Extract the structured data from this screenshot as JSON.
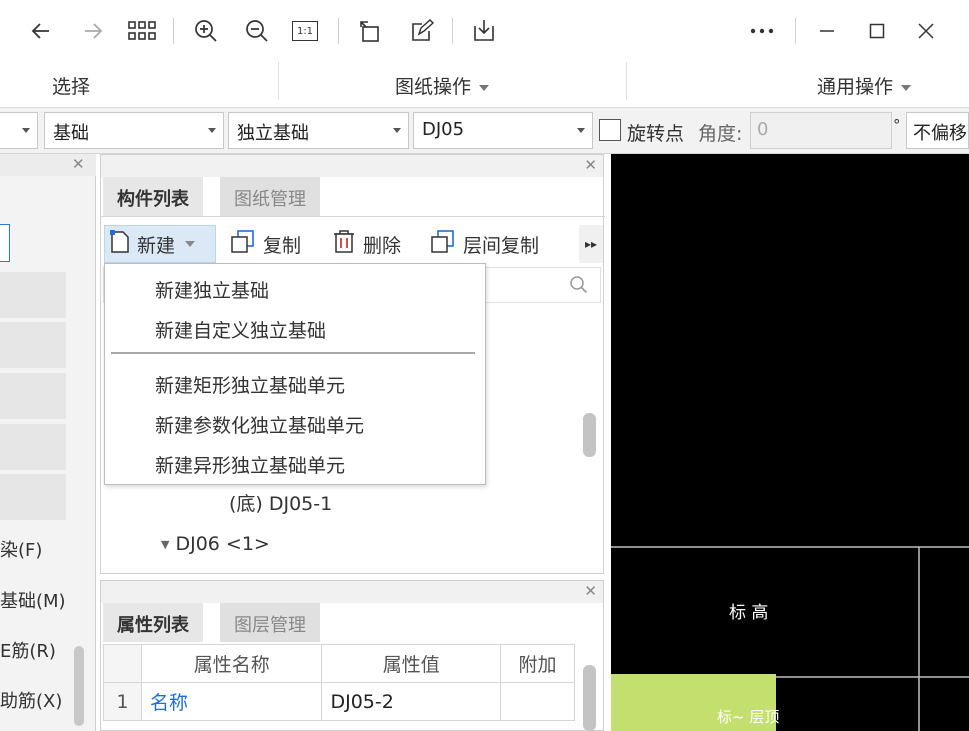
{
  "titlebar": {
    "back_icon": "arrow-left-icon",
    "forward_icon": "arrow-right-icon",
    "grid_icon": "grid-icon",
    "zoom_in_icon": "zoom-in-icon",
    "zoom_out_icon": "zoom-out-icon",
    "fit_label": "1:1",
    "rotate_icon": "rotate-icon",
    "edit_icon": "edit-icon",
    "download_icon": "download-icon",
    "more_icon": "more-icon",
    "minimize_icon": "minimize-icon",
    "maximize_icon": "maximize-icon",
    "close_icon": "close-icon"
  },
  "ribbon": {
    "group1": "选择",
    "group2": "图纸操作",
    "group3": "通用操作"
  },
  "filterbar": {
    "combo0": "",
    "combo1": "基础",
    "combo2": "独立基础",
    "combo3": "DJ05",
    "rotate_point_label": "旋转点",
    "angle_label": "角度:",
    "angle_value": "0",
    "degree_symbol": "°",
    "offset_label": "不偏移"
  },
  "left_panel": {
    "items": [
      "染(F)",
      "基础(M)",
      "E筋(R)",
      "助筋(X)"
    ]
  },
  "component_panel": {
    "tabs": [
      "构件列表",
      "图纸管理"
    ],
    "toolbar": {
      "new_label": "新建",
      "copy_label": "复制",
      "delete_label": "删除",
      "floor_copy_label": "层间复制"
    },
    "dropdown": {
      "items": [
        "新建独立基础",
        "新建自定义独立基础",
        "新建矩形独立基础单元",
        "新建参数化独立基础单元",
        "新建异形独立基础单元"
      ]
    },
    "tree": {
      "item1": "(底) DJ05-1",
      "item2": "DJ06 <1>"
    }
  },
  "property_panel": {
    "tabs": [
      "属性列表",
      "图层管理"
    ],
    "columns": [
      "属性名称",
      "属性值",
      "附加"
    ],
    "rows": [
      {
        "index": "1",
        "name": "名称",
        "value": "DJ05-2",
        "extra": ""
      }
    ]
  },
  "canvas": {
    "label1": "标 高",
    "label2": "标~ 层顶"
  },
  "colors": {
    "accent_blue": "#1e6fd9",
    "canvas_bg": "#000000",
    "canvas_green": "#c3e06e"
  }
}
